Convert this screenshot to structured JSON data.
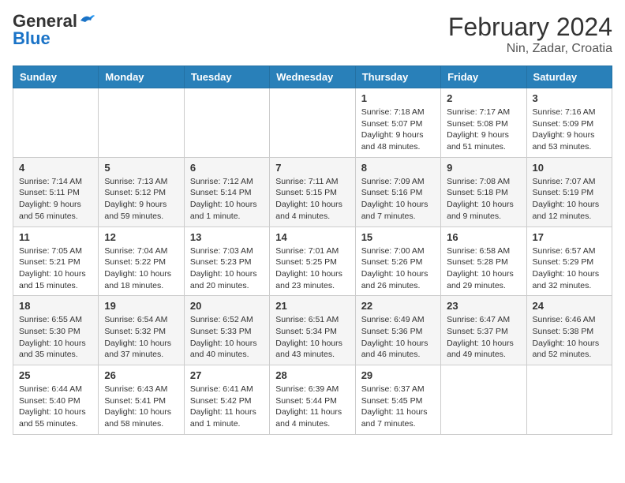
{
  "header": {
    "logo_general": "General",
    "logo_blue": "Blue",
    "title": "February 2024",
    "subtitle": "Nin, Zadar, Croatia"
  },
  "days_of_week": [
    "Sunday",
    "Monday",
    "Tuesday",
    "Wednesday",
    "Thursday",
    "Friday",
    "Saturday"
  ],
  "weeks": [
    [
      {
        "day": "",
        "info": ""
      },
      {
        "day": "",
        "info": ""
      },
      {
        "day": "",
        "info": ""
      },
      {
        "day": "",
        "info": ""
      },
      {
        "day": "1",
        "info": "Sunrise: 7:18 AM\nSunset: 5:07 PM\nDaylight: 9 hours and 48 minutes."
      },
      {
        "day": "2",
        "info": "Sunrise: 7:17 AM\nSunset: 5:08 PM\nDaylight: 9 hours and 51 minutes."
      },
      {
        "day": "3",
        "info": "Sunrise: 7:16 AM\nSunset: 5:09 PM\nDaylight: 9 hours and 53 minutes."
      }
    ],
    [
      {
        "day": "4",
        "info": "Sunrise: 7:14 AM\nSunset: 5:11 PM\nDaylight: 9 hours and 56 minutes."
      },
      {
        "day": "5",
        "info": "Sunrise: 7:13 AM\nSunset: 5:12 PM\nDaylight: 9 hours and 59 minutes."
      },
      {
        "day": "6",
        "info": "Sunrise: 7:12 AM\nSunset: 5:14 PM\nDaylight: 10 hours and 1 minute."
      },
      {
        "day": "7",
        "info": "Sunrise: 7:11 AM\nSunset: 5:15 PM\nDaylight: 10 hours and 4 minutes."
      },
      {
        "day": "8",
        "info": "Sunrise: 7:09 AM\nSunset: 5:16 PM\nDaylight: 10 hours and 7 minutes."
      },
      {
        "day": "9",
        "info": "Sunrise: 7:08 AM\nSunset: 5:18 PM\nDaylight: 10 hours and 9 minutes."
      },
      {
        "day": "10",
        "info": "Sunrise: 7:07 AM\nSunset: 5:19 PM\nDaylight: 10 hours and 12 minutes."
      }
    ],
    [
      {
        "day": "11",
        "info": "Sunrise: 7:05 AM\nSunset: 5:21 PM\nDaylight: 10 hours and 15 minutes."
      },
      {
        "day": "12",
        "info": "Sunrise: 7:04 AM\nSunset: 5:22 PM\nDaylight: 10 hours and 18 minutes."
      },
      {
        "day": "13",
        "info": "Sunrise: 7:03 AM\nSunset: 5:23 PM\nDaylight: 10 hours and 20 minutes."
      },
      {
        "day": "14",
        "info": "Sunrise: 7:01 AM\nSunset: 5:25 PM\nDaylight: 10 hours and 23 minutes."
      },
      {
        "day": "15",
        "info": "Sunrise: 7:00 AM\nSunset: 5:26 PM\nDaylight: 10 hours and 26 minutes."
      },
      {
        "day": "16",
        "info": "Sunrise: 6:58 AM\nSunset: 5:28 PM\nDaylight: 10 hours and 29 minutes."
      },
      {
        "day": "17",
        "info": "Sunrise: 6:57 AM\nSunset: 5:29 PM\nDaylight: 10 hours and 32 minutes."
      }
    ],
    [
      {
        "day": "18",
        "info": "Sunrise: 6:55 AM\nSunset: 5:30 PM\nDaylight: 10 hours and 35 minutes."
      },
      {
        "day": "19",
        "info": "Sunrise: 6:54 AM\nSunset: 5:32 PM\nDaylight: 10 hours and 37 minutes."
      },
      {
        "day": "20",
        "info": "Sunrise: 6:52 AM\nSunset: 5:33 PM\nDaylight: 10 hours and 40 minutes."
      },
      {
        "day": "21",
        "info": "Sunrise: 6:51 AM\nSunset: 5:34 PM\nDaylight: 10 hours and 43 minutes."
      },
      {
        "day": "22",
        "info": "Sunrise: 6:49 AM\nSunset: 5:36 PM\nDaylight: 10 hours and 46 minutes."
      },
      {
        "day": "23",
        "info": "Sunrise: 6:47 AM\nSunset: 5:37 PM\nDaylight: 10 hours and 49 minutes."
      },
      {
        "day": "24",
        "info": "Sunrise: 6:46 AM\nSunset: 5:38 PM\nDaylight: 10 hours and 52 minutes."
      }
    ],
    [
      {
        "day": "25",
        "info": "Sunrise: 6:44 AM\nSunset: 5:40 PM\nDaylight: 10 hours and 55 minutes."
      },
      {
        "day": "26",
        "info": "Sunrise: 6:43 AM\nSunset: 5:41 PM\nDaylight: 10 hours and 58 minutes."
      },
      {
        "day": "27",
        "info": "Sunrise: 6:41 AM\nSunset: 5:42 PM\nDaylight: 11 hours and 1 minute."
      },
      {
        "day": "28",
        "info": "Sunrise: 6:39 AM\nSunset: 5:44 PM\nDaylight: 11 hours and 4 minutes."
      },
      {
        "day": "29",
        "info": "Sunrise: 6:37 AM\nSunset: 5:45 PM\nDaylight: 11 hours and 7 minutes."
      },
      {
        "day": "",
        "info": ""
      },
      {
        "day": "",
        "info": ""
      }
    ]
  ]
}
